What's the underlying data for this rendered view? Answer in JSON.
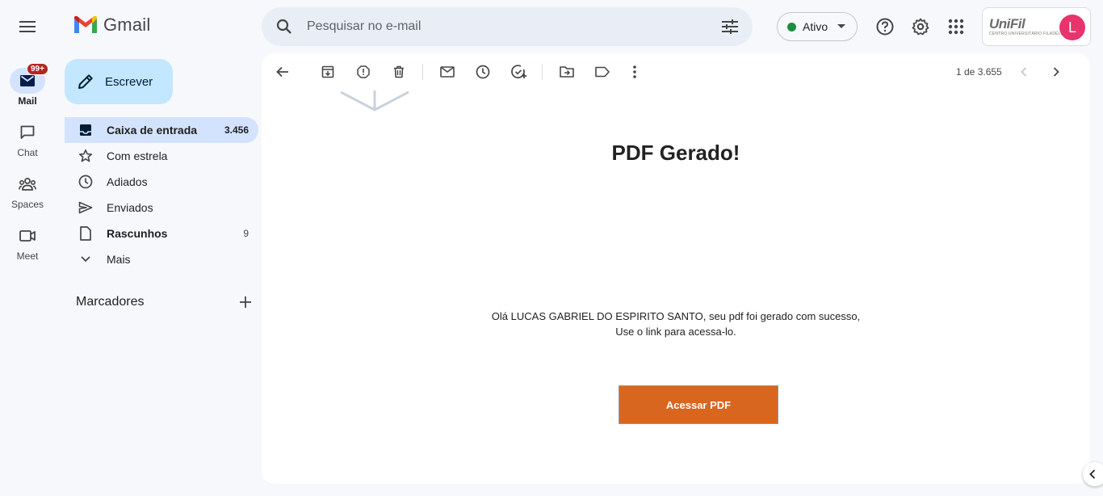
{
  "app": {
    "name": "Gmail"
  },
  "search": {
    "placeholder": "Pesquisar no e-mail"
  },
  "status": {
    "label": "Ativo",
    "color": "#1e8e3e"
  },
  "account": {
    "brand": "UniFil",
    "brand_sub": "CENTRO UNIVERSITÁRIO FILADÉLFIA",
    "avatar_letter": "L",
    "avatar_color": "#e8336d"
  },
  "rail": {
    "mail": {
      "label": "Mail",
      "badge": "99+"
    },
    "chat": {
      "label": "Chat"
    },
    "spaces": {
      "label": "Spaces"
    },
    "meet": {
      "label": "Meet"
    }
  },
  "compose": {
    "label": "Escrever"
  },
  "nav": {
    "inbox": {
      "label": "Caixa de entrada",
      "count": "3.456"
    },
    "starred": {
      "label": "Com estrela"
    },
    "snoozed": {
      "label": "Adiados"
    },
    "sent": {
      "label": "Enviados"
    },
    "drafts": {
      "label": "Rascunhos",
      "count": "9"
    },
    "more": {
      "label": "Mais"
    }
  },
  "labels": {
    "title": "Marcadores"
  },
  "toolbar": {
    "pager": "1 de 3.655"
  },
  "email": {
    "title": "PDF Gerado!",
    "line1": "Olá LUCAS GABRIEL DO ESPIRITO SANTO, seu pdf foi gerado com sucesso,",
    "line2": "Use o link para acessa-lo.",
    "button": "Acessar PDF",
    "button_color": "#d9661f"
  }
}
